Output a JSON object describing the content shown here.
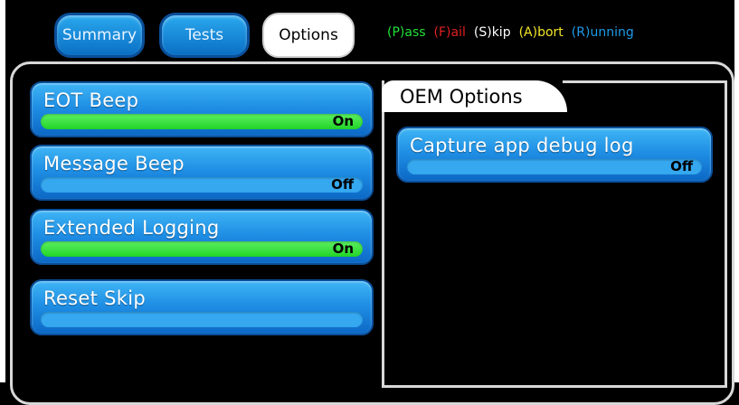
{
  "tabs": [
    {
      "label": "Summary"
    },
    {
      "label": "Tests"
    },
    {
      "label": "Options"
    }
  ],
  "legend": [
    {
      "label": "(P)ass",
      "color": "#22e039"
    },
    {
      "label": "(F)ail",
      "color": "#e02020"
    },
    {
      "label": "(S)kip",
      "color": "#ffffff"
    },
    {
      "label": "(A)bort",
      "color": "#f2e52a"
    },
    {
      "label": "(R)unning",
      "color": "#1e9be8"
    }
  ],
  "settings": [
    {
      "label": "EOT Beep",
      "state": "On"
    },
    {
      "label": "Message Beep",
      "state": "Off"
    },
    {
      "label": "Extended Logging",
      "state": "On"
    },
    {
      "label": "Reset Skip",
      "state": ""
    }
  ],
  "oem": {
    "title": "OEM Options",
    "items": [
      {
        "label": "Capture app debug log",
        "state": "Off"
      }
    ]
  }
}
